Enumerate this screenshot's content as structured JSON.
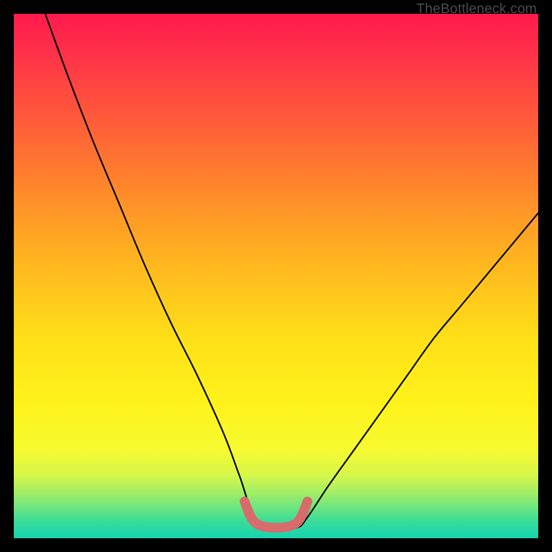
{
  "watermark": "TheBottleneck.com",
  "chart_data": {
    "type": "line",
    "title": "",
    "xlabel": "",
    "ylabel": "",
    "xlim": [
      0,
      100
    ],
    "ylim": [
      0,
      100
    ],
    "grid": false,
    "series": [
      {
        "name": "bottleneck-curve",
        "x": [
          6,
          10,
          15,
          20,
          25,
          30,
          35,
          40,
          43,
          46,
          50,
          54,
          56,
          60,
          65,
          70,
          75,
          80,
          85,
          90,
          95,
          100
        ],
        "y": [
          100,
          89,
          76,
          64,
          52,
          41,
          31,
          20,
          12,
          4,
          2,
          2,
          4,
          10,
          17,
          24,
          31,
          38,
          44,
          50,
          56,
          62
        ]
      },
      {
        "name": "optimal-band",
        "x": [
          44,
          46,
          50,
          54,
          56
        ],
        "y": [
          7,
          3,
          2,
          3,
          7
        ]
      }
    ],
    "colors": {
      "curve": "#000000",
      "optimal_band": "#d86b6b",
      "gradient_top": "#ff1a4d",
      "gradient_mid": "#ffe018",
      "gradient_bottom": "#16d4b0"
    }
  }
}
